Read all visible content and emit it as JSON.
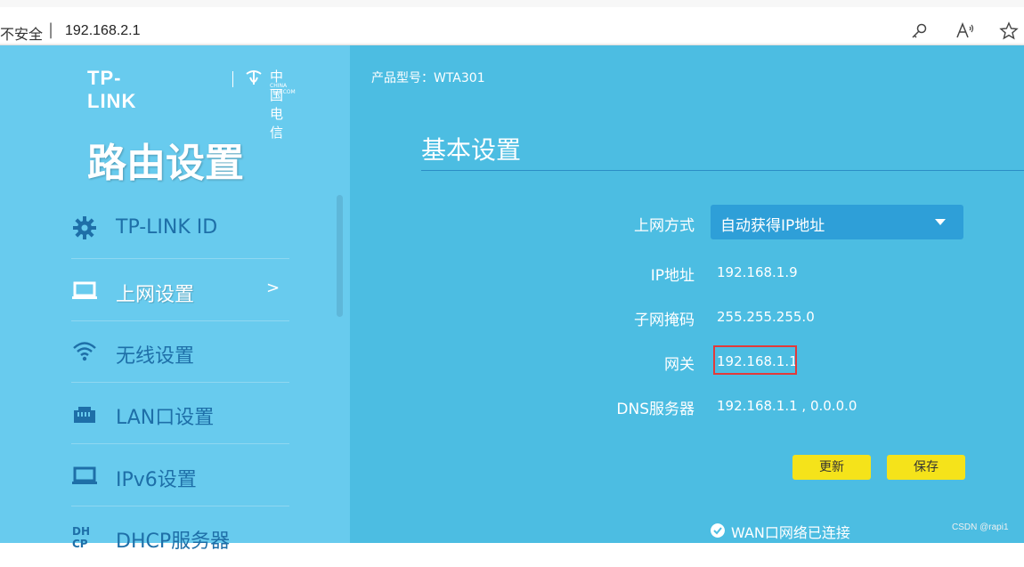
{
  "browser": {
    "security_text": "不安全",
    "separator": "|",
    "url": "192.168.2.1",
    "icons": [
      "key-icon",
      "read-aloud-icon",
      "favorite-star-icon"
    ]
  },
  "sidebar": {
    "brand": "TP-LINK",
    "partner_cn": "中国电信",
    "partner_en": "CHINA TELECOM",
    "title": "路由设置",
    "items": [
      {
        "label": "TP-LINK ID",
        "icon": "gear-icon",
        "active": false
      },
      {
        "label": "上网设置",
        "icon": "laptop-icon",
        "active": true,
        "arrow": ">"
      },
      {
        "label": "无线设置",
        "icon": "wifi-icon",
        "active": false
      },
      {
        "label": "LAN口设置",
        "icon": "lan-port-icon",
        "active": false
      },
      {
        "label": "IPv6设置",
        "icon": "laptop-icon",
        "active": false
      },
      {
        "label": "DHCP服务器",
        "icon": "dhcp-icon",
        "active": false
      }
    ]
  },
  "main": {
    "model_label": "产品型号：WTA301",
    "section_title": "基本设置",
    "connection_type": {
      "label": "上网方式",
      "value": "自动获得IP地址"
    },
    "ip": {
      "label": "IP地址",
      "value": "192.168.1.9"
    },
    "subnet": {
      "label": "子网掩码",
      "value": "255.255.255.0"
    },
    "gateway": {
      "label": "网关",
      "value": "192.168.1.1"
    },
    "dns": {
      "label": "DNS服务器",
      "value": "192.168.1.1 , 0.0.0.0"
    },
    "buttons": {
      "update": "更新",
      "save": "保存"
    },
    "status": "WAN口网络已连接"
  },
  "watermark": "CSDN @rapi1",
  "colors": {
    "sidebar_bg": "#68cbee",
    "main_bg": "#4cbde2",
    "button_yellow": "#f5e31a",
    "highlight_red": "#e23a3a"
  }
}
